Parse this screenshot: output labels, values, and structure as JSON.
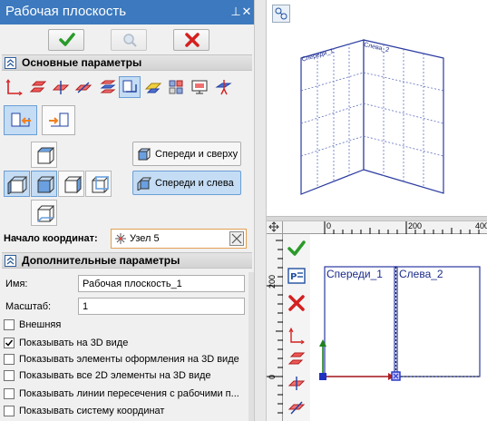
{
  "panel": {
    "title": "Рабочая плоскость",
    "pin_glyph": "⊥",
    "close_glyph": "✕"
  },
  "sections": {
    "main_params": "Основные параметры",
    "extra_params": "Дополнительные параметры"
  },
  "view_buttons": {
    "front_top": "Спереди и сверху",
    "front_left": "Спереди и слева"
  },
  "origin": {
    "label": "Начало координат:",
    "value": "Узел 5"
  },
  "fields": {
    "name_label": "Имя:",
    "name_value": "Рабочая плоскость_1",
    "scale_label": "Масштаб:",
    "scale_value": "1"
  },
  "checkboxes": [
    {
      "label": "Внешняя",
      "checked": false
    },
    {
      "label": "Показывать на 3D виде",
      "checked": true
    },
    {
      "label": "Показывать элементы оформления на 3D виде",
      "checked": false
    },
    {
      "label": "Показывать все 2D элементы на 3D виде",
      "checked": false
    },
    {
      "label": "Показывать линии пересечения с рабочими п...",
      "checked": false
    },
    {
      "label": "Показывать систему координат",
      "checked": false
    }
  ],
  "viewport3d": {
    "plane_front": "Спереди_1",
    "plane_left": "Слева_2"
  },
  "viewport2d": {
    "ruler_top": [
      "0",
      "200",
      "400"
    ],
    "ruler_left": [
      "200",
      "0"
    ],
    "plane_front": "Спереди_1",
    "plane_left": "Слева_2"
  },
  "colors": {
    "title_bar": "#3c79be",
    "accent_green": "#2a9a2a",
    "accent_red": "#d42020",
    "plane_text": "#1a2a8a",
    "selection": "#c4dcf4"
  }
}
